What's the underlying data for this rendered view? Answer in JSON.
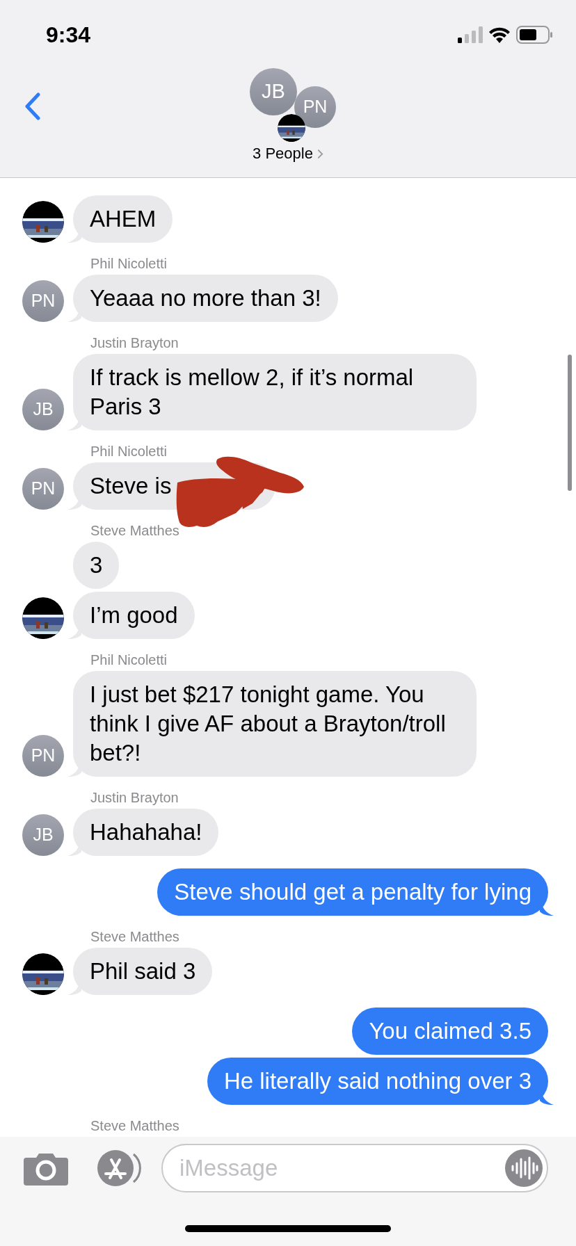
{
  "status_bar": {
    "time": "9:34"
  },
  "header": {
    "avatars": [
      {
        "kind": "initials",
        "initials": "JB"
      },
      {
        "kind": "initials",
        "initials": "PN"
      },
      {
        "kind": "picture"
      }
    ],
    "title": "3 People"
  },
  "messages": [
    {
      "kind": "bubble",
      "text": "AHEM",
      "outgoing": false,
      "avatar": {
        "kind": "picture"
      }
    },
    {
      "kind": "sender",
      "name": "Phil Nicoletti"
    },
    {
      "kind": "bubble",
      "text": "Yeaaa no more than 3!",
      "outgoing": false,
      "avatar": {
        "kind": "initials",
        "initials": "PN"
      }
    },
    {
      "kind": "sender",
      "name": "Justin Brayton"
    },
    {
      "kind": "bubble",
      "text": "If track is mellow 2, if it’s normal Paris 3",
      "outgoing": false,
      "avatar": {
        "kind": "initials",
        "initials": "JB"
      }
    },
    {
      "kind": "sender",
      "name": "Phil Nicoletti"
    },
    {
      "kind": "bubble",
      "text": "Steve is",
      "outgoing": false,
      "redacted": true,
      "avatar": {
        "kind": "initials",
        "initials": "PN"
      }
    },
    {
      "kind": "sender",
      "name": "Steve Matthes"
    },
    {
      "kind": "bubble",
      "text": "3",
      "outgoing": false
    },
    {
      "kind": "bubble",
      "text": "I’m good",
      "outgoing": false,
      "avatar": {
        "kind": "picture"
      }
    },
    {
      "kind": "sender",
      "name": "Phil Nicoletti"
    },
    {
      "kind": "bubble",
      "text": "I just bet $217 tonight game. You think I give AF about a Brayton/troll bet?!",
      "outgoing": false,
      "avatar": {
        "kind": "initials",
        "initials": "PN"
      }
    },
    {
      "kind": "sender",
      "name": "Justin Brayton"
    },
    {
      "kind": "bubble",
      "text": "Hahahaha!",
      "outgoing": false,
      "avatar": {
        "kind": "initials",
        "initials": "JB"
      }
    },
    {
      "kind": "bubble",
      "text": "Steve should get a penalty for lying",
      "outgoing": true,
      "tail": true
    },
    {
      "kind": "sender",
      "name": "Steve Matthes"
    },
    {
      "kind": "bubble",
      "text": "Phil said 3",
      "outgoing": false,
      "avatar": {
        "kind": "picture"
      }
    },
    {
      "kind": "bubble",
      "text": "You claimed 3.5",
      "outgoing": true,
      "tail": false
    },
    {
      "kind": "bubble",
      "text": "He literally said nothing over 3",
      "outgoing": true,
      "tail": true
    },
    {
      "kind": "sender",
      "name": "Steve Matthes"
    }
  ],
  "composer": {
    "placeholder": "iMessage"
  }
}
